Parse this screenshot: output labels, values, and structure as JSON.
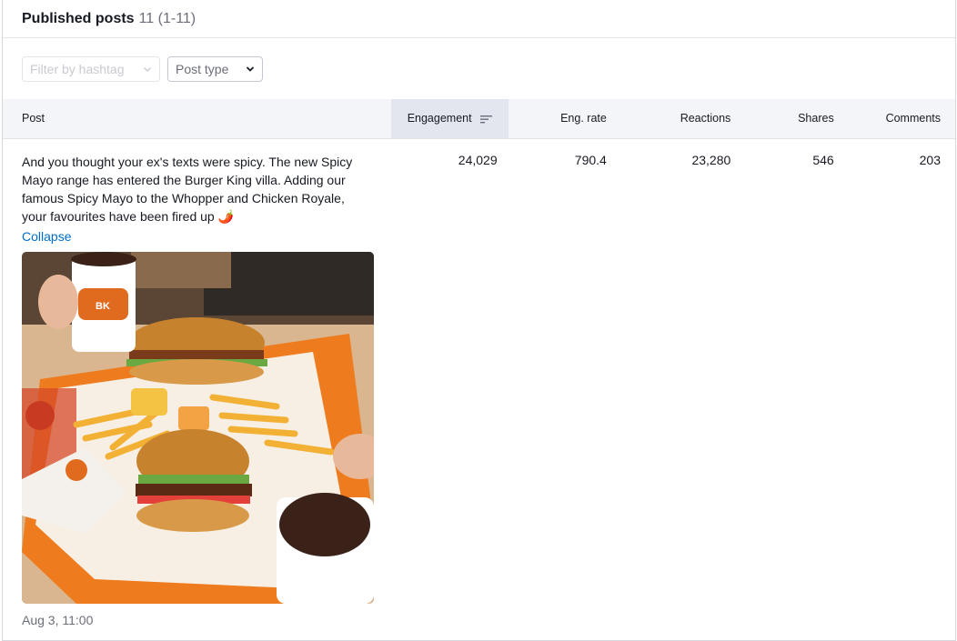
{
  "header": {
    "title": "Published posts",
    "count": "11 (1-11)"
  },
  "filters": {
    "hashtag_placeholder": "Filter by hashtag",
    "post_type_label": "Post type"
  },
  "table": {
    "columns": [
      "Post",
      "Engagement",
      "Eng. rate",
      "Reactions",
      "Shares",
      "Comments"
    ],
    "sorted_column": "Engagement",
    "rows": [
      {
        "post_text": "And you thought your ex's texts were spicy. The new Spicy Mayo range has entered the Burger King villa. Adding our famous Spicy Mayo to the Whopper and Chicken Royale, your favourites have been fired up 🌶️",
        "collapse_label": "Collapse",
        "image_icon": "burger-king-meal-photo",
        "date": "Aug 3, 11:00",
        "engagement": "24,029",
        "eng_rate": "790.4",
        "reactions": "23,280",
        "shares": "546",
        "comments": "203"
      }
    ]
  },
  "colors": {
    "accent_link": "#006dca",
    "header_bg": "#f4f5f9",
    "sorted_bg": "#e3e6ee"
  }
}
